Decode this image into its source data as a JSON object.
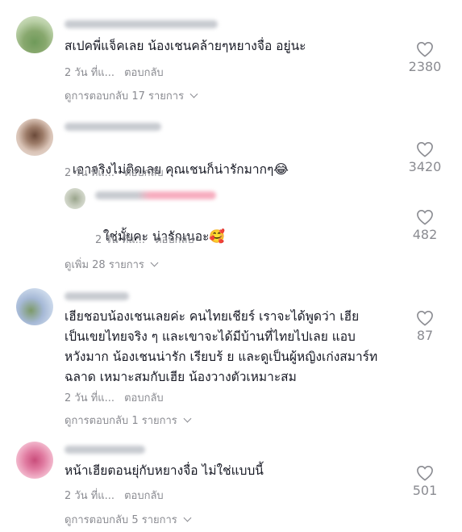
{
  "comments": [
    {
      "text": "สเปคพี่แจ็คเลย น้องเชนคล้ายๆหยางจื่อ อยู่นะ",
      "time": "2 วัน ที่แ...",
      "reply": "ตอบกลับ",
      "likes": "2380",
      "view_replies": "ดูการตอบกลับ 17 รายการ"
    },
    {
      "text": "เอาจริงไม่ติดเลย คุณเชนก็น่ารักมากๆ",
      "emoji": "😂",
      "time": "2 วัน ที่แ...",
      "reply": "ตอบกลับ",
      "likes": "3420",
      "sub_reply": {
        "text": "ใช่มั้ยคะ น่ารักเนอะ",
        "emoji": "🥰",
        "time": "2 วัน ที่แ...",
        "reply": "ตอบกลับ",
        "likes": "482"
      },
      "view_replies": "ดูเพิ่ม 28 รายการ"
    },
    {
      "text": "เฮียชอบน้องเชนเลยค่ะ คนไทยเชียร์ เราจะได้พูดว่า เฮีย\nเป็นเขยไทยจริง ๆ และเขาจะได้มีบ้านที่ไทยไปเลย แอบ\nหวังมาก น้องเชนน่ารัก เรียบร้ ย และดูเป็นผู้หญิงเก่งสมาร์ท\nฉลาด เหมาะสมกับเฮีย น้องวางตัวเหมาะสม",
      "time": "2 วัน ที่แ...",
      "reply": "ตอบกลับ",
      "likes": "87",
      "view_replies": "ดูการตอบกลับ 1 รายการ"
    },
    {
      "text": "หน้าเฮียตอนยุ่กับหยางจื่อ ไม่ใช่แบบนี้",
      "time": "2 วัน ที่แ...",
      "reply": "ตอบกลับ",
      "likes": "501",
      "view_replies": "ดูการตอบกลับ 5 รายการ"
    }
  ],
  "colors": {
    "text": "#161823",
    "secondary": "#8a8b91",
    "heart_stroke": "#8a8b91"
  },
  "icons": {
    "like": "heart-outline-icon",
    "expand": "chevron-down-icon"
  }
}
